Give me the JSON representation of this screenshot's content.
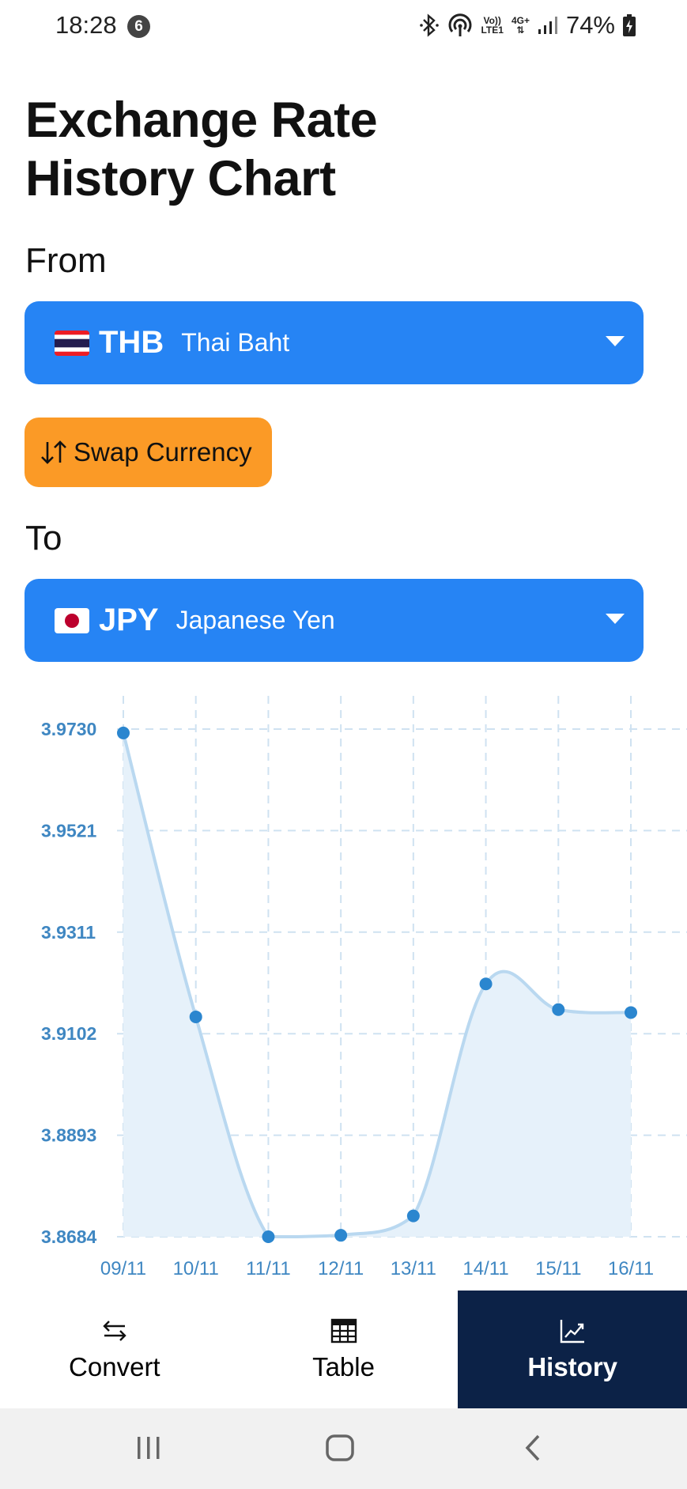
{
  "status_bar": {
    "time": "18:28",
    "notification_count": "6",
    "network_top": "Vo))",
    "network_bottom": "LTE1",
    "network_type": "4G+",
    "battery": "74%"
  },
  "title": "Exchange Rate History Chart",
  "from": {
    "label": "From",
    "code": "THB",
    "name": "Thai Baht",
    "flag": "thailand-flag-icon"
  },
  "swap": {
    "label": "Swap Currency"
  },
  "to": {
    "label": "To",
    "code": "JPY",
    "name": "Japanese Yen",
    "flag": "japan-flag-icon"
  },
  "colors": {
    "select_blue": "#2684f4",
    "swap_orange": "#fb9a26",
    "nav_active": "#0c2247",
    "chart_line": "#b9d8f0",
    "chart_point": "#2b86cf",
    "tick_text": "#3f87c2"
  },
  "chart_data": {
    "type": "area",
    "x": [
      "09/11",
      "10/11",
      "11/11",
      "12/11",
      "13/11",
      "14/11",
      "15/11",
      "16/11"
    ],
    "values": [
      3.9722,
      3.9137,
      3.8684,
      3.8687,
      3.8727,
      3.9205,
      3.9152,
      3.9146
    ],
    "y_ticks": [
      "3.9730",
      "3.9521",
      "3.9311",
      "3.9102",
      "3.8893",
      "3.8684"
    ],
    "ylim": [
      3.8684,
      3.973
    ],
    "grid": true
  },
  "nav": [
    {
      "label": "Convert",
      "icon": "swap-arrows-icon",
      "active": false
    },
    {
      "label": "Table",
      "icon": "table-icon",
      "active": false
    },
    {
      "label": "History",
      "icon": "trend-chart-icon",
      "active": true
    }
  ]
}
